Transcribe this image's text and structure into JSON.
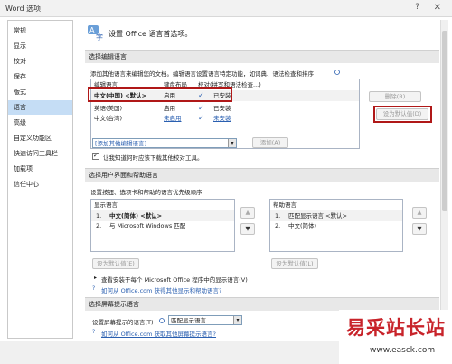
{
  "window": {
    "title": "Word 选项",
    "help": "?",
    "close": "✕"
  },
  "sidebar": {
    "items": [
      {
        "label": "常规"
      },
      {
        "label": "显示"
      },
      {
        "label": "校对"
      },
      {
        "label": "保存"
      },
      {
        "label": "版式"
      },
      {
        "label": "语言"
      },
      {
        "label": "高级"
      },
      {
        "label": "自定义功能区"
      },
      {
        "label": "快速访问工具栏"
      },
      {
        "label": "加载项"
      },
      {
        "label": "信任中心"
      }
    ]
  },
  "header": {
    "title": "设置 Office 语言首选项。"
  },
  "editing": {
    "title": "选择编辑语言",
    "desc": "添加其他语言来编辑您的文档。编辑语言设置语言特定功能，如词典、语法检查和排序",
    "columns": [
      "编辑语言",
      "键盘布局",
      "校对(拼写和语法检查...)"
    ],
    "rows": [
      {
        "lang": "中文(中国) <默认>",
        "kb": "启用",
        "status": "已安装"
      },
      {
        "lang": "英语(美国)",
        "kb": "启用",
        "status": "已安装"
      },
      {
        "lang": "中文(台湾)",
        "kb": "未启用",
        "status": "未安装"
      }
    ],
    "remove_btn": "删除(R)",
    "default_btn": "设为默认值(D)",
    "add_dropdown": "[添加其他编辑语言]",
    "add_btn": "添加(A)",
    "checkbox": "让我知道何时应该下载其他校对工具。"
  },
  "ui": {
    "title": "选择用户界面和帮助语言",
    "desc": "设置按钮、选项卡和帮助的语言优先级顺序",
    "display": {
      "title": "显示语言",
      "rows": [
        {
          "num": "1.",
          "lang": "中文(简体) <默认>"
        },
        {
          "num": "2.",
          "lang": "与 Microsoft Windows 匹配"
        }
      ]
    },
    "help": {
      "title": "帮助语言",
      "rows": [
        {
          "num": "1.",
          "lang": "匹配显示语言 <默认>"
        },
        {
          "num": "2.",
          "lang": "中文(简体)"
        }
      ]
    },
    "set_default": "设为默认值(E)",
    "set_default_help": "设为默认值(L)",
    "view_installed": "查看安装于每个 Microsoft Office 程序中的显示语言(V)",
    "link": "如何从 Office.com 获得其他显示和帮助语言?"
  },
  "screentip": {
    "title": "选择屏幕提示语言",
    "label": "设置屏幕提示的语言(T)",
    "value": "匹配显示语言",
    "link": "如何从 Office.com 获取其他屏幕提示语言?"
  },
  "watermark": {
    "big": "易采站长站",
    "small": "www.easck.com"
  }
}
